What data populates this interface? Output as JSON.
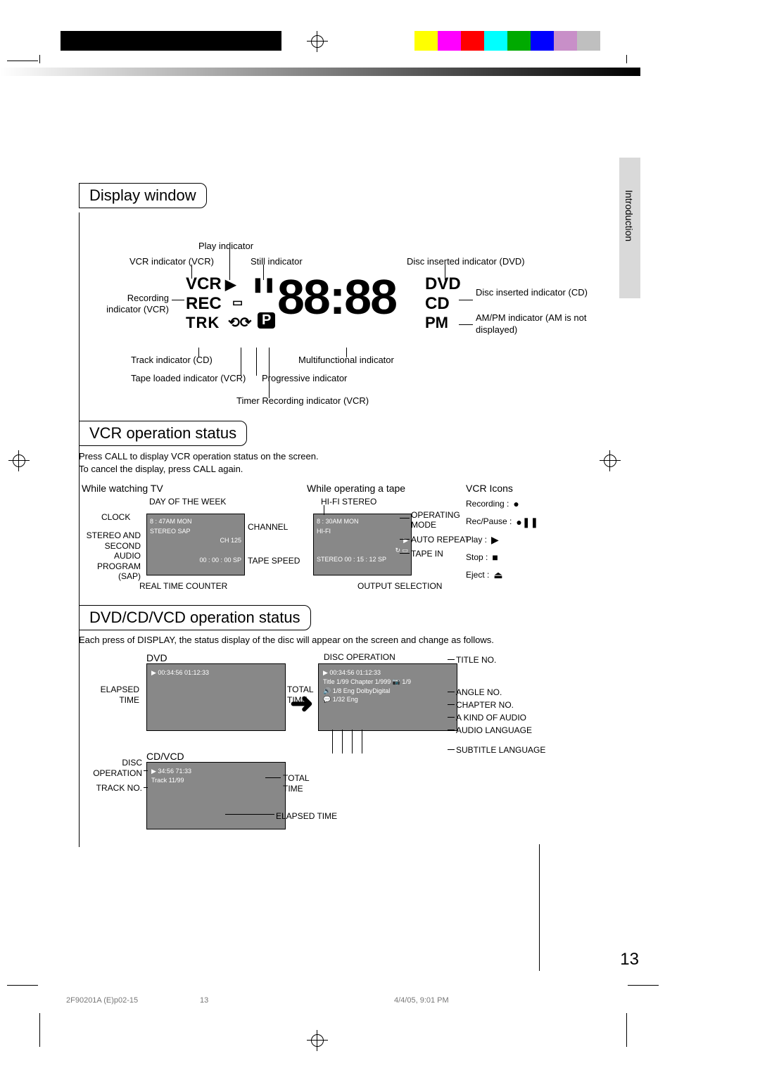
{
  "side_tab": "Introduction",
  "page_number": "13",
  "footer": {
    "docid": "2F90201A (E)p02-15",
    "page": "13",
    "date": "4/4/05, 9:01 PM"
  },
  "color_swatches": [
    "#ffffff",
    "#ffff00",
    "#ff00ff",
    "#ff0000",
    "#00ffff",
    "#00aa00",
    "#0000ff",
    "#c88fc8",
    "#bfbfbf"
  ],
  "display": {
    "title": "Display window",
    "labels": {
      "play_indicator": "Play indicator",
      "vcr_indicator": "VCR indicator (VCR)",
      "still_indicator": "Still indicator",
      "disc_dvd": "Disc inserted indicator (DVD)",
      "recording": "Recording indicator (VCR)",
      "disc_cd": "Disc inserted indicator (CD)",
      "ampm": "AM/PM indicator (AM is not displayed)",
      "track_cd": "Track indicator (CD)",
      "tape_loaded": "Tape loaded indicator (VCR)",
      "timer_rec": "Timer Recording indicator (VCR)",
      "multi": "Multifunctional indicator",
      "progressive": "Progressive indicator"
    },
    "core": {
      "vcr": "VCR",
      "rec": "REC",
      "trk": "TRK",
      "p": "P",
      "digits": "88:88",
      "dvd": "DVD",
      "cd": "CD",
      "pm": "PM",
      "play_glyph": "▶",
      "pause_glyph": "❚❚",
      "tape_glyph": "⟲⟳",
      "cassette_glyph": "▭"
    }
  },
  "vcr": {
    "title": "VCR operation status",
    "desc1": "Press CALL to display VCR operation status on the screen.",
    "desc2": "To cancel the display, press CALL again.",
    "col1_title": "While watching TV",
    "col2_title": "While operating a tape",
    "icons_title": "VCR Icons",
    "labels": {
      "day_of_week": "DAY OF THE WEEK",
      "clock": "CLOCK",
      "channel": "CHANNEL",
      "tape_speed": "TAPE SPEED",
      "stereo_sap": "STEREO AND SECOND AUDIO PROGRAM (SAP)",
      "real_time_counter": "REAL TIME COUNTER",
      "hifi": "HI-FI STEREO",
      "operating_mode": "OPERATING MODE",
      "auto_repeat": "AUTO REPEAT",
      "tape_in": "TAPE IN",
      "output_selection": "OUTPUT SELECTION"
    },
    "osd1": {
      "l1": "8 : 47AM  MON",
      "l2": "STEREO  SAP",
      "l3": "CH 125",
      "l4": "00 : 00 : 00  SP"
    },
    "osd2": {
      "l1": "8 : 30AM  MON",
      "l2": "HI-FI",
      "l3": "▶",
      "l4a": "↻ ▭",
      "l4": "STEREO        00 : 15 : 12  SP"
    },
    "icons": {
      "recording": "Recording :",
      "rec_glyph": "●",
      "recpause": "Rec/Pause :",
      "recpause_glyph": "●❚❚",
      "play": "Play :",
      "play_glyph": "▶",
      "stop": "Stop :",
      "stop_glyph": "■",
      "eject": "Eject :",
      "eject_glyph": "⏏"
    }
  },
  "dvd": {
    "title": "DVD/CD/VCD operation status",
    "desc": "Each press of DISPLAY, the status display of the disc will appear on the screen and change as follows.",
    "labels": {
      "dvd": "DVD",
      "cdvcd": "CD/VCD",
      "elapsed_time": "ELAPSED TIME",
      "total_time": "TOTAL TIME",
      "disc_operation": "DISC OPERATION",
      "track_no": "TRACK NO.",
      "elapsed_time2": "ELAPSED TIME",
      "title_no": "TITLE NO.",
      "angle_no": "ANGLE NO.",
      "chapter_no": "CHAPTER NO.",
      "kind_audio": "A KIND OF AUDIO",
      "audio_lang": "AUDIO LANGUAGE",
      "subtitle_lang": "SUBTITLE LANGUAGE"
    },
    "osd_dvd1": {
      "l1": "▶                 00:34:56  01:12:33"
    },
    "osd_dvd2": {
      "l1": "▶                00:34:56  01:12:33",
      "l2": "Title      1/99   Chapter  1/999   📷 1/9",
      "l3": "🔊 1/8  Eng  DolbyDigital",
      "l4": "💬 1/32  Eng"
    },
    "osd_cd": {
      "l1": "▶                   34:56      71:33",
      "l2": "Track 11/99"
    }
  }
}
